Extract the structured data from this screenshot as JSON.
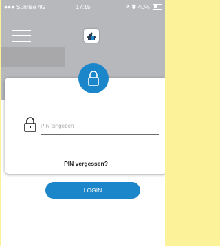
{
  "status_bar": {
    "carrier": "Sunrise",
    "network": "4G",
    "time": "17:15",
    "battery": "40%"
  },
  "pin": {
    "placeholder": "PIN eingeben"
  },
  "forgot_pin": "PIN vergessen?",
  "login_label": "LOGIN",
  "colors": {
    "accent": "#1b86c9",
    "header_background": "#b7b8bc",
    "page_background": "#fcf29a"
  },
  "icons": {
    "menu": "menu-icon",
    "logo": "app-logo-icon",
    "lock_badge": "lock-icon",
    "pin_field": "lock-icon"
  }
}
